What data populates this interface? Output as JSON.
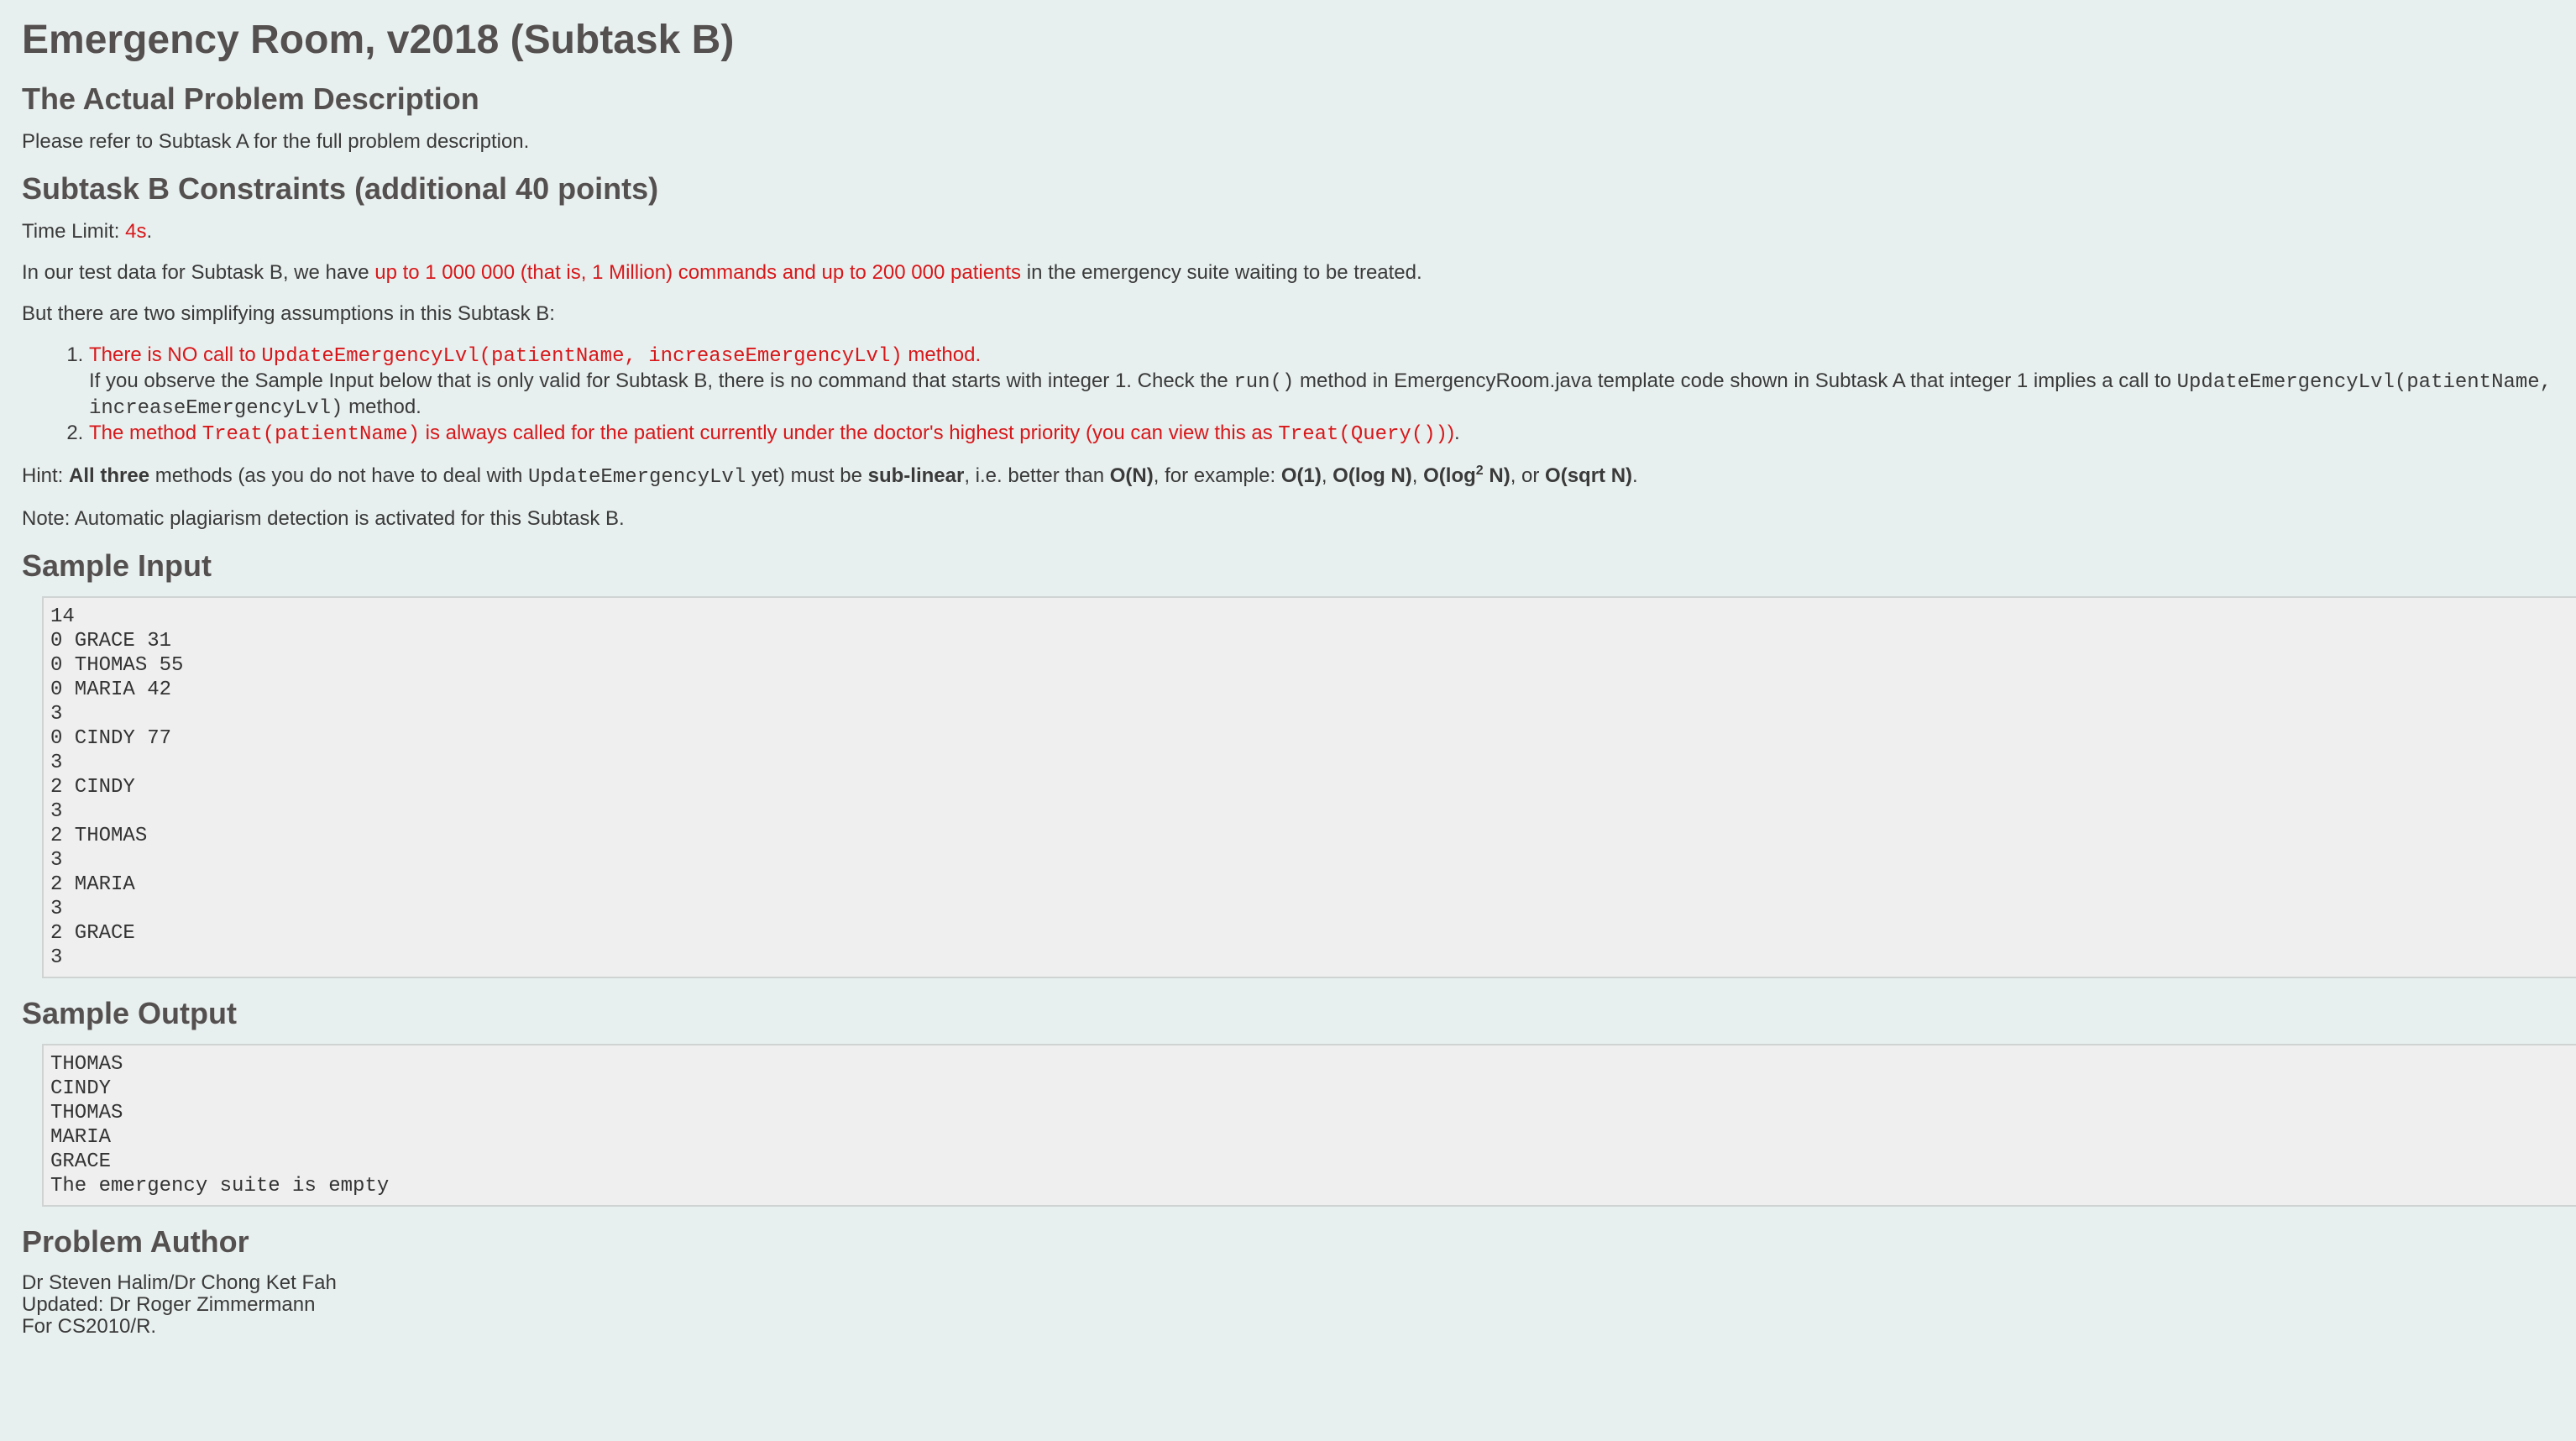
{
  "title": "Emergency Room, v2018 (Subtask B)",
  "sections": {
    "actual_problem": {
      "heading": "The Actual Problem Description",
      "text": "Please refer to Subtask A for the full problem description."
    },
    "constraints": {
      "heading": "Subtask B Constraints (additional 40 points)",
      "time_limit_prefix": "Time Limit: ",
      "time_limit_value": "4s",
      "time_limit_suffix": ".",
      "test_data_prefix": "In our test data for Subtask B, we have ",
      "test_data_highlight": "up to 1 000 000 (that is, 1 Million) commands and up to 200 000 patients",
      "test_data_suffix": " in the emergency suite waiting to be treated.",
      "assumptions_intro": "But there are two simplifying assumptions in this Subtask B:",
      "item1_a": "There is NO call to ",
      "item1_code": "UpdateEmergencyLvl(patientName, increaseEmergencyLvl)",
      "item1_b": " method.",
      "item1_note_a": "If you observe the Sample Input below that is only valid for Subtask B, there is no command that starts with integer 1. Check the ",
      "item1_note_code1": "run()",
      "item1_note_b": " method in EmergencyRoom.java template code shown in Subtask A that integer 1 implies a call to ",
      "item1_note_code2": "UpdateEmergencyLvl(patientName, increaseEmergencyLvl)",
      "item1_note_c": " method.",
      "item2_a": "The method ",
      "item2_code1": "Treat(patientName)",
      "item2_b": " is always called for the patient currently under the doctor's highest priority (you can view this as ",
      "item2_code2": "Treat(Query())",
      "item2_c": ")",
      "item2_end": ".",
      "hint_prefix": "Hint: ",
      "hint_bold1": "All three",
      "hint_a": " methods (as you do not have to deal with ",
      "hint_code": "UpdateEmergencyLvl",
      "hint_b": " yet) must be ",
      "hint_bold2": "sub-linear",
      "hint_c": ", i.e. better than ",
      "hint_on": "O(N)",
      "hint_d": ", for example: ",
      "hint_o1": "O(1)",
      "hint_sep1": ", ",
      "hint_ologn": "O(log N)",
      "hint_sep2": ", ",
      "hint_olog2_a": "O(log",
      "hint_olog2_sup": "2",
      "hint_olog2_b": " N)",
      "hint_sep3": ", or ",
      "hint_osqrt": "O(sqrt N)",
      "hint_end": ".",
      "note": "Note: Automatic plagiarism detection is activated for this Subtask B."
    },
    "sample_input": {
      "heading": "Sample Input",
      "content": "14\n0 GRACE 31\n0 THOMAS 55\n0 MARIA 42\n3\n0 CINDY 77\n3\n2 CINDY\n3\n2 THOMAS\n3\n2 MARIA\n3\n2 GRACE\n3"
    },
    "sample_output": {
      "heading": "Sample Output",
      "content": "THOMAS\nCINDY\nTHOMAS\nMARIA\nGRACE\nThe emergency suite is empty"
    },
    "author": {
      "heading": "Problem Author",
      "line1": "Dr Steven Halim/Dr Chong Ket Fah",
      "line2": "Updated: Dr Roger Zimmermann",
      "line3": "For CS2010/R."
    }
  }
}
